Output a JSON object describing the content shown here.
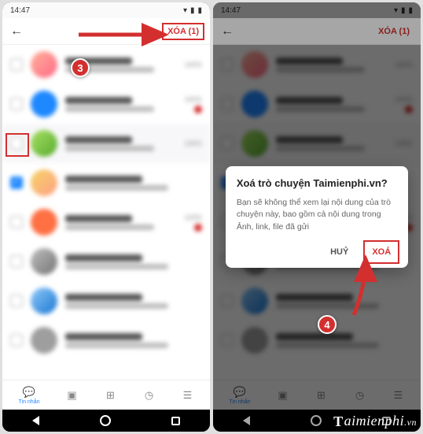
{
  "statusbar": {
    "time": "14:47"
  },
  "appbar": {
    "delete_label_left": "XÓA (1)",
    "delete_label_right": "XÓA (1)"
  },
  "dialog": {
    "title": "Xoá trò chuyện Taimienphi.vn?",
    "body": "Bạn sẽ không thể xem lại nội dung của trò chuyện này, bao gồm cả nội dung trong Ảnh, link, file đã gửi",
    "cancel": "HUỶ",
    "confirm": "XOÁ"
  },
  "bottom_nav": {
    "tab1": "Tin nhắn"
  },
  "chats": [
    {
      "date": "14/01",
      "badge": false,
      "checked": false
    },
    {
      "date": "14/01",
      "badge": true,
      "checked": false
    },
    {
      "date": "13/01",
      "badge": false,
      "checked": false
    },
    {
      "date": "",
      "badge": false,
      "checked": true
    },
    {
      "date": "12/01",
      "badge": true,
      "checked": false
    },
    {
      "date": "",
      "badge": false,
      "checked": false
    },
    {
      "date": "",
      "badge": false,
      "checked": false
    },
    {
      "date": "",
      "badge": false,
      "checked": false
    }
  ],
  "steps": {
    "s3": "3",
    "s4": "4"
  },
  "watermark": {
    "text_a": "T",
    "text_b": "aimienphi",
    "text_c": ".vn"
  }
}
